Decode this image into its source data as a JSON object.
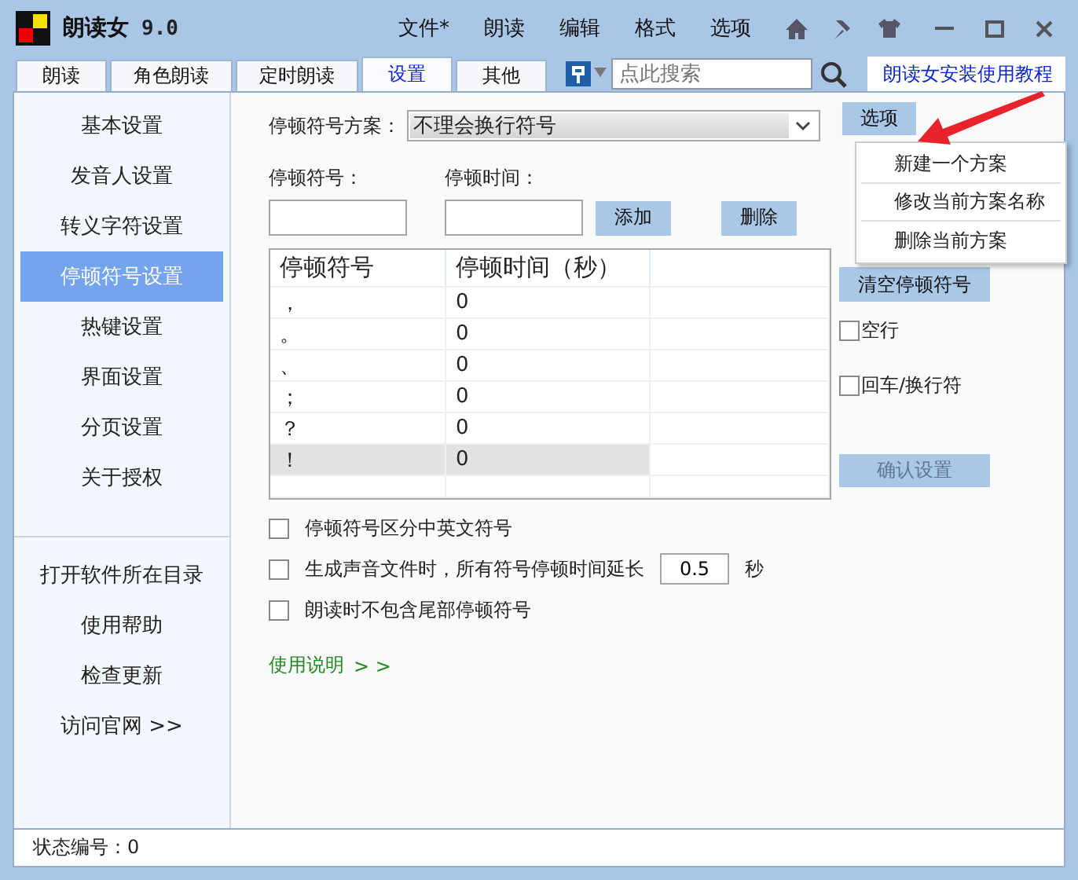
{
  "window": {
    "title": "朗读女",
    "version": "9.0",
    "menu": [
      "文件*",
      "朗读",
      "编辑",
      "格式",
      "选项"
    ]
  },
  "tabs": [
    {
      "label": "朗读",
      "selected": false
    },
    {
      "label": "角色朗读",
      "selected": false
    },
    {
      "label": "定时朗读",
      "selected": false
    },
    {
      "label": "设置",
      "selected": true
    },
    {
      "label": "其他",
      "selected": false
    }
  ],
  "search": {
    "placeholder": "点此搜索"
  },
  "tutorial_link": "朗读女安装使用教程",
  "sidebar": {
    "items": [
      {
        "label": "基本设置",
        "selected": false
      },
      {
        "label": "发音人设置",
        "selected": false
      },
      {
        "label": "转义字符设置",
        "selected": false
      },
      {
        "label": "停顿符号设置",
        "selected": true
      },
      {
        "label": "热键设置",
        "selected": false
      },
      {
        "label": "界面设置",
        "selected": false
      },
      {
        "label": "分页设置",
        "selected": false
      },
      {
        "label": "关于授权",
        "selected": false
      }
    ],
    "links": [
      "打开软件所在目录",
      "使用帮助",
      "检查更新",
      "访问官网 >>"
    ]
  },
  "pause_settings": {
    "scheme_label": "停顿符号方案：",
    "scheme_value": "不理会换行符号",
    "options_button": "选项",
    "options_menu": [
      "新建一个方案",
      "修改当前方案名称",
      "删除当前方案"
    ],
    "symbol_label": "停顿符号：",
    "time_label": "停顿时间：",
    "add_button": "添加",
    "delete_button": "删除",
    "table": {
      "columns": [
        "停顿符号",
        "停顿时间（秒）"
      ],
      "rows": [
        {
          "cells": [
            "，",
            "0"
          ],
          "selected": false
        },
        {
          "cells": [
            "。",
            "0"
          ],
          "selected": false
        },
        {
          "cells": [
            "、",
            "0"
          ],
          "selected": false
        },
        {
          "cells": [
            "；",
            "0"
          ],
          "selected": false
        },
        {
          "cells": [
            "？",
            "0"
          ],
          "selected": false
        },
        {
          "cells": [
            "！",
            "0"
          ],
          "selected": true
        }
      ]
    },
    "clear_button": "清空停顿符号",
    "side_checks": [
      {
        "label": "空行",
        "checked": false
      },
      {
        "label": "回车/换行符",
        "checked": false
      }
    ],
    "confirm_button": {
      "label": "确认设置",
      "disabled": true
    },
    "options": [
      {
        "label": "停顿符号区分中英文符号",
        "checked": false
      },
      {
        "label": "生成声音文件时，所有符号停顿时间延长",
        "checked": false,
        "value": "0.5",
        "unit": "秒"
      },
      {
        "label": "朗读时不包含尾部停顿符号",
        "checked": false
      }
    ],
    "help_link": {
      "label": "使用说明",
      "arrows": "> >"
    }
  },
  "status_bar": "状态编号：0"
}
